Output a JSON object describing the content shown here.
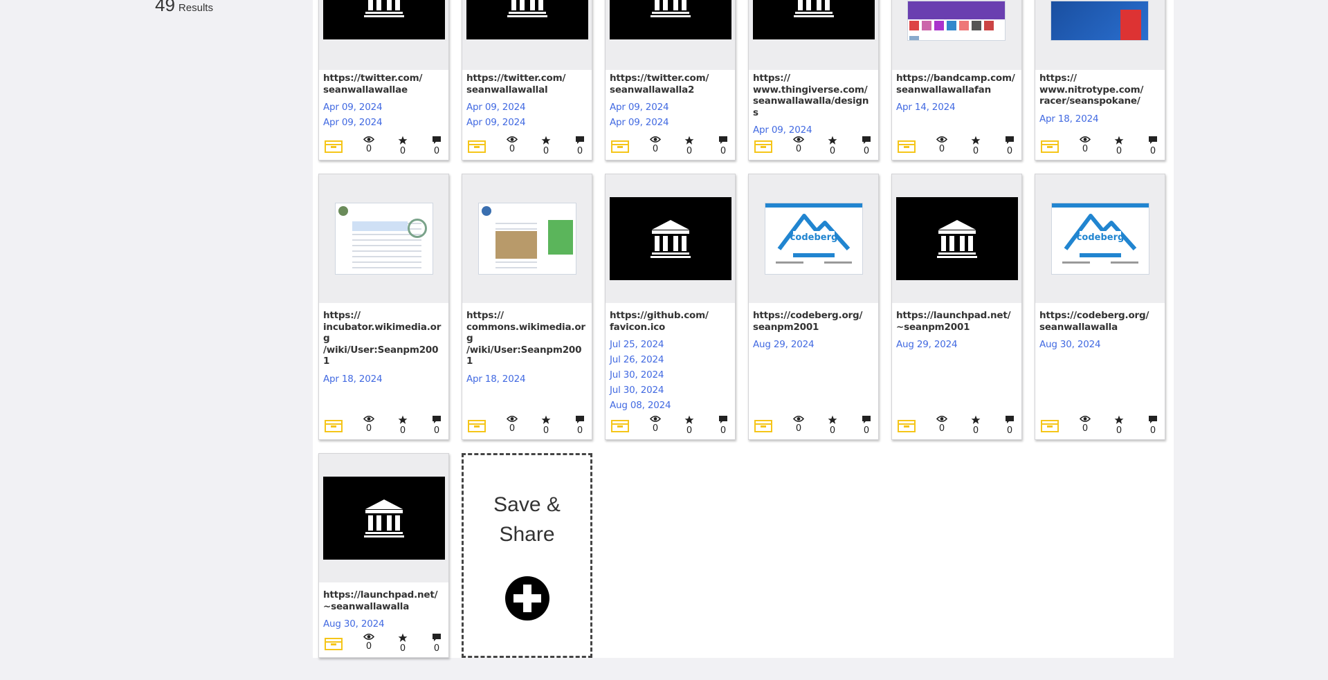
{
  "results": {
    "count": "49",
    "label": "Results"
  },
  "cards": [
    {
      "url": "https://twitter.com/\nseanwallawallae",
      "dates": [
        "Apr 09, 2024",
        "Apr 09, 2024"
      ],
      "thumb": "archive-icon",
      "views": "0",
      "stars": "0",
      "comments": "0"
    },
    {
      "url": "https://twitter.com/\nseanwallawallal",
      "dates": [
        "Apr 09, 2024",
        "Apr 09, 2024"
      ],
      "thumb": "archive-icon",
      "views": "0",
      "stars": "0",
      "comments": "0"
    },
    {
      "url": "https://twitter.com/\nseanwallawalla2",
      "dates": [
        "Apr 09, 2024",
        "Apr 09, 2024"
      ],
      "thumb": "archive-icon",
      "views": "0",
      "stars": "0",
      "comments": "0"
    },
    {
      "url": "https://\nwww.thingiverse.com/\nseanwallawalla/designs",
      "dates": [
        "Apr 09, 2024"
      ],
      "thumb": "archive-icon",
      "views": "0",
      "stars": "0",
      "comments": "0"
    },
    {
      "url": "https://bandcamp.com/\nseanwallawallafan",
      "dates": [
        "Apr 14, 2024"
      ],
      "thumb": "bandcamp-screenshot",
      "views": "0",
      "stars": "0",
      "comments": "0"
    },
    {
      "url": "https://\nwww.nitrotype.com/\nracer/seanspokane/",
      "dates": [
        "Apr 18, 2024"
      ],
      "thumb": "nitrotype-screenshot",
      "views": "0",
      "stars": "0",
      "comments": "0"
    },
    {
      "url": "https://\nincubator.wikimedia.org\n/wiki/User:Seanpm2001",
      "dates": [
        "Apr 18, 2024"
      ],
      "thumb": "wiki-screenshot",
      "views": "0",
      "stars": "0",
      "comments": "0"
    },
    {
      "url": "https://\ncommons.wikimedia.org\n/wiki/User:Seanpm2001",
      "dates": [
        "Apr 18, 2024"
      ],
      "thumb": "commons-screenshot",
      "views": "0",
      "stars": "0",
      "comments": "0"
    },
    {
      "url": "https://github.com/\nfavicon.ico",
      "dates": [
        "Jul 25, 2024",
        "Jul 26, 2024",
        "Jul 30, 2024",
        "Jul 30, 2024",
        "Aug 08, 2024"
      ],
      "thumb": "archive-icon",
      "views": "0",
      "stars": "0",
      "comments": "0"
    },
    {
      "url": "https://codeberg.org/\nseanpm2001",
      "dates": [
        "Aug 29, 2024"
      ],
      "thumb": "codeberg-screenshot",
      "views": "0",
      "stars": "0",
      "comments": "0"
    },
    {
      "url": "https://launchpad.net/\n~seanpm2001",
      "dates": [
        "Aug 29, 2024"
      ],
      "thumb": "archive-icon",
      "views": "0",
      "stars": "0",
      "comments": "0"
    },
    {
      "url": "https://codeberg.org/\nseanwallawalla",
      "dates": [
        "Aug 30, 2024"
      ],
      "thumb": "codeberg-screenshot",
      "views": "0",
      "stars": "0",
      "comments": "0"
    },
    {
      "url": "https://launchpad.net/\n~seanwallawalla",
      "dates": [
        "Aug 30, 2024"
      ],
      "thumb": "archive-icon",
      "views": "0",
      "stars": "0",
      "comments": "0"
    }
  ],
  "save_card": {
    "label": "Save & Share",
    "icon": "plus-circle-icon"
  },
  "colors": {
    "date": "#4169e1",
    "folder": "#f5c518",
    "codeberg": "#2185d0"
  }
}
